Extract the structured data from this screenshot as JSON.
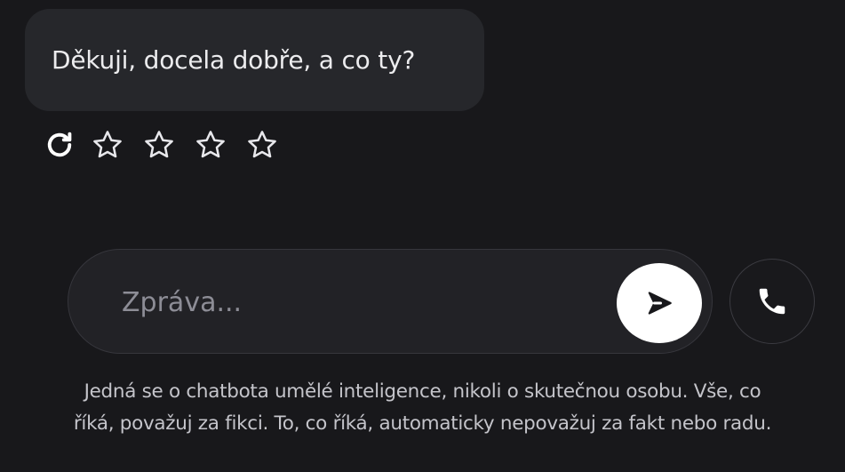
{
  "message": {
    "text": "Děkuji, docela dobře, a co ty?"
  },
  "actions": {
    "regenerate_icon": "refresh-icon",
    "rating": {
      "max": 5,
      "value": 0,
      "star_icon": "star-outline-icon"
    }
  },
  "composer": {
    "value": "",
    "placeholder": "Zpráva...",
    "send_icon": "send-icon",
    "call_icon": "phone-icon"
  },
  "disclaimer": {
    "line1": "Jedná se o chatbota umělé inteligence, nikoli o skutečnou osobu. Vše, co",
    "line2": "říká, považuj za fikci. To, co říká, automaticky nepovažuj za fakt nebo radu."
  },
  "colors": {
    "background": "#18181b",
    "bubble": "#26272b",
    "composer": "#222226",
    "send_button": "#ffffff",
    "text": "#ececee",
    "placeholder": "#8d8d96"
  }
}
